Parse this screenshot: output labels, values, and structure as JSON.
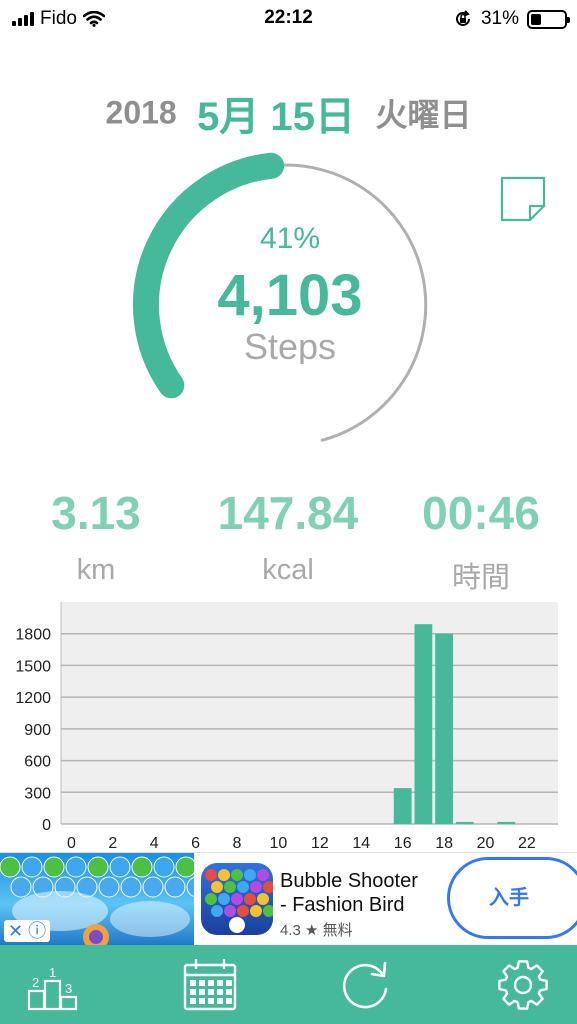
{
  "status_bar": {
    "carrier": "Fido",
    "time": "22:12",
    "battery_percent": "31%",
    "battery_level": 0.31,
    "icons": [
      "signal-bars-icon",
      "wifi-icon",
      "orientation-lock-icon",
      "battery-icon"
    ]
  },
  "date": {
    "year": "2018",
    "month_day": "5月 15日",
    "weekday": "火曜日"
  },
  "progress": {
    "percent_label": "41%",
    "fraction": 0.41,
    "steps": "4,103",
    "steps_label": "Steps"
  },
  "stats": {
    "distance": {
      "value": "3.13",
      "unit": "km"
    },
    "calories": {
      "value": "147.84",
      "unit": "kcal"
    },
    "time": {
      "value": "00:46",
      "unit": "時間"
    }
  },
  "chart_data": {
    "type": "bar",
    "x": [
      0,
      1,
      2,
      3,
      4,
      5,
      6,
      7,
      8,
      9,
      10,
      11,
      12,
      13,
      14,
      15,
      16,
      17,
      18,
      19,
      20,
      21,
      22,
      23
    ],
    "values": [
      0,
      0,
      0,
      0,
      0,
      0,
      0,
      0,
      0,
      0,
      0,
      0,
      0,
      0,
      0,
      0,
      340,
      1890,
      1800,
      20,
      0,
      20,
      0,
      0
    ],
    "xticks": [
      "0",
      "2",
      "4",
      "6",
      "8",
      "10",
      "12",
      "14",
      "16",
      "18",
      "20",
      "22"
    ],
    "yticks": [
      "0",
      "300",
      "600",
      "900",
      "1200",
      "1500",
      "1800"
    ],
    "ylim": [
      0,
      2100
    ],
    "grid": true,
    "bar_color": "#45b99a",
    "plot_background": "#efefef"
  },
  "ad": {
    "title_line1": "Bubble Shooter",
    "title_line2": "- Fashion Bird",
    "rating": "4.3 ★ 無料",
    "get_label": "入手",
    "close_label": "✕ ⓘ"
  },
  "tabbar": {
    "items": [
      {
        "name": "ranking-icon"
      },
      {
        "name": "calendar-icon"
      },
      {
        "name": "refresh-icon"
      },
      {
        "name": "gear-icon"
      }
    ]
  },
  "colors": {
    "accent": "#45b99a",
    "accent_light": "#7fd0b4",
    "gray_text": "#8f8f8f",
    "ad_blue": "#3478f6"
  }
}
